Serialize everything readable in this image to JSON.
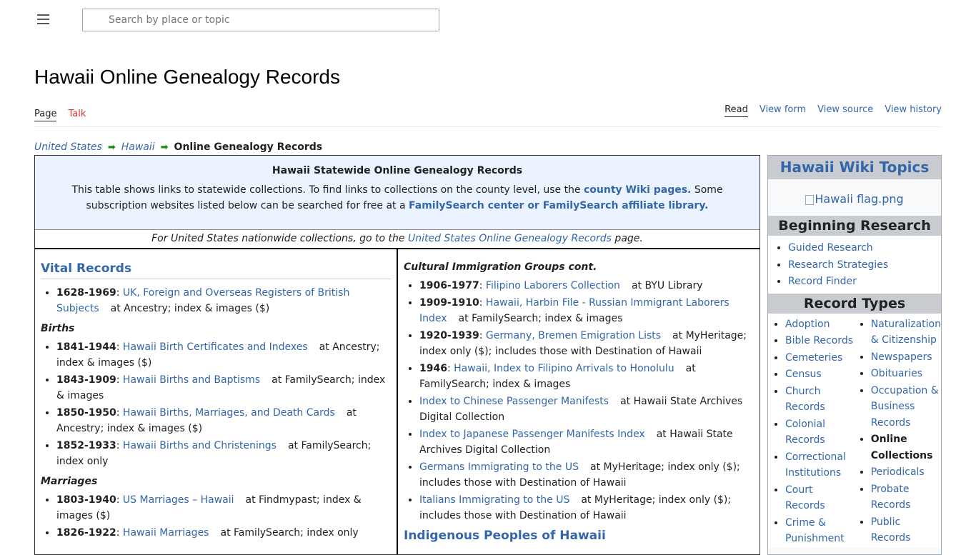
{
  "header": {
    "search_placeholder": "Search by place or topic"
  },
  "page": {
    "title": "Hawaii Online Genealogy Records",
    "tabs_left": [
      "Page",
      "Talk"
    ],
    "tabs_right": [
      "Read",
      "View form",
      "View source",
      "View history"
    ]
  },
  "breadcrumb": {
    "items": [
      "United States",
      "Hawaii"
    ],
    "current": "Online Genealogy Records"
  },
  "intro": {
    "heading": "Hawaii Statewide Online Genealogy Records",
    "text1": "This table shows links to statewide collections. To find links to collections on the county level, use the ",
    "link1": "county Wiki pages.",
    "text2": " Some subscription websites listed below can be searched for free at a ",
    "link2": "FamilySearch center or FamilySearch affiliate library."
  },
  "nationwide": {
    "prefix": "For United States nationwide collections, go to the ",
    "link": "United States Online Genealogy Records",
    "suffix": " page."
  },
  "left": {
    "section": "Vital Records",
    "vital": [
      {
        "years": "1628-1969",
        "title": "UK, Foreign and Overseas Registers of British Subjects",
        "site": "at Ancestry; index & images ($)"
      }
    ],
    "births_label": "Births",
    "births": [
      {
        "years": "1841-1944",
        "title": "Hawaii Birth Certificates and Indexes",
        "site": "at Ancestry; index & images ($)"
      },
      {
        "years": "1843-1909",
        "title": "Hawaii Births and Baptisms",
        "site": "at FamilySearch; index & images"
      },
      {
        "years": "1850-1950",
        "title": "Hawaii Births, Marriages, and Death Cards",
        "site": "at Ancestry; index & images ($)"
      },
      {
        "years": "1852-1933",
        "title": "Hawaii Births and Christenings",
        "site": "at FamilySearch; index only"
      }
    ],
    "marriages_label": "Marriages",
    "marriages": [
      {
        "years": "1803-1940",
        "title": "US Marriages – Hawaii",
        "site": "at Findmypast; index & images ($)"
      },
      {
        "years": "1826-1922",
        "title": "Hawaii Marriages",
        "site": "at FamilySearch; index only"
      }
    ]
  },
  "right": {
    "subheading": "Cultural Immigration Groups cont.",
    "items": [
      {
        "years": "1906-1977",
        "title": "Filipino Laborers Collection",
        "site": "at BYU Library"
      },
      {
        "years": "1909-1910",
        "title": "Hawaii, Harbin File - Russian Immigrant Laborers Index",
        "site": "at FamilySearch; index & images"
      },
      {
        "years": "1920-1939",
        "title": "Germany, Bremen Emigration Lists",
        "site": "at MyHeritage; index only ($); includes those with Destination of Hawaii"
      },
      {
        "years": "1946",
        "title": "Hawaii, Index to Filipino Arrivals to Honolulu",
        "site": "at FamilySearch; index & images"
      },
      {
        "years": "",
        "title": "Index to Chinese Passenger Manifests",
        "site": "at Hawaii State Archives Digital Collection"
      },
      {
        "years": "",
        "title": "Index to Japanese Passenger Manifests Index",
        "site": "at Hawaii State Archives Digital Collection"
      },
      {
        "years": "",
        "title": "Germans Immigrating to the US",
        "site": "at MyHeritage; index only ($); includes those with Destination of Hawaii"
      },
      {
        "years": "",
        "title": "Italians Immigrating to the US",
        "site": "at MyHeritage; index only ($); includes those with Destination of Hawaii"
      }
    ],
    "section": "Indigenous Peoples of Hawaii"
  },
  "sidebar": {
    "title": "Hawaii Wiki Topics",
    "flag_alt": "Hawaii flag.png",
    "beginning_label": "Beginning Research",
    "beginning": [
      "Guided Research",
      "Research Strategies",
      "Record Finder"
    ],
    "record_types_label": "Record Types",
    "col1": [
      "Adoption",
      "Bible Records",
      "Cemeteries",
      "Census",
      "Church Records",
      "Colonial Records",
      "Correctional Institutions",
      "Court Records",
      "Crime & Punishment"
    ],
    "col2": [
      "Naturalization & Citizenship",
      "Newspapers",
      "Obituaries",
      "Occupation & Business Records",
      "Online Collections",
      "Periodicals",
      "Probate Records",
      "Public Records"
    ],
    "current": "Online Collections"
  }
}
